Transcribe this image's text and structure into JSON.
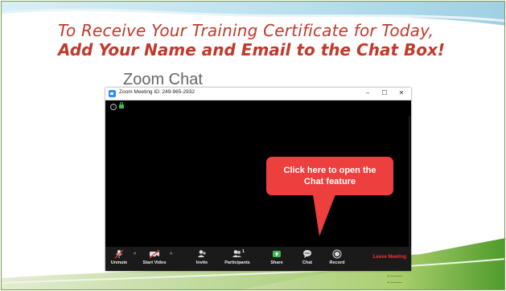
{
  "slide": {
    "title_line1": "To Receive Your Training Certificate for Today,",
    "title_line2": "Add Your Name and Email to the Chat Box!",
    "background_heading": "Zoom Chat"
  },
  "window": {
    "title": "Zoom Meeting ID: 249-965-2932",
    "minimize_glyph": "–",
    "maximize_glyph": "☐",
    "close_glyph": "✕"
  },
  "toolbar": {
    "unmute_label": "Unmute",
    "start_video_label": "Start Video",
    "invite_label": "Invite",
    "participants_label": "Participants",
    "participants_count": "1",
    "share_label": "Share",
    "chat_label": "Chat",
    "record_label": "Record",
    "leave_label": "Leave Meeting",
    "caret_glyph": "^"
  },
  "callout": {
    "text_line1": "Click here to open the",
    "text_line2": "Chat feature"
  },
  "colors": {
    "title_red": "#c0392b",
    "callout_red": "#ee3f3f",
    "zoom_blue": "#2d8cff",
    "share_green": "#3fb94c",
    "leave_red": "#e33333"
  }
}
